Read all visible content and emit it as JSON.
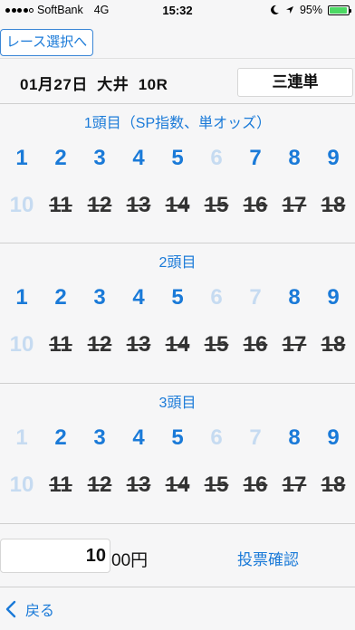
{
  "status_bar": {
    "carrier": "SoftBank",
    "network": "4G",
    "time": "15:32",
    "battery": "95%",
    "battery_level": 0.95,
    "signal_bars_filled": 4,
    "signal_bars_total": 5
  },
  "header": {
    "race_select_label": "レース選択へ",
    "race_info": "01月27日  大井  10R",
    "bet_type": "三連単"
  },
  "sections": [
    {
      "title": "1頭目（SP指数、単オッズ）",
      "rows": [
        [
          {
            "n": "1",
            "state": "active"
          },
          {
            "n": "2",
            "state": "active"
          },
          {
            "n": "3",
            "state": "active"
          },
          {
            "n": "4",
            "state": "active"
          },
          {
            "n": "5",
            "state": "active"
          },
          {
            "n": "6",
            "state": "dim"
          },
          {
            "n": "7",
            "state": "active"
          },
          {
            "n": "8",
            "state": "active"
          },
          {
            "n": "9",
            "state": "active"
          }
        ],
        [
          {
            "n": "10",
            "state": "dim"
          },
          {
            "n": "11",
            "state": "scratched"
          },
          {
            "n": "12",
            "state": "scratched"
          },
          {
            "n": "13",
            "state": "scratched"
          },
          {
            "n": "14",
            "state": "scratched"
          },
          {
            "n": "15",
            "state": "scratched"
          },
          {
            "n": "16",
            "state": "scratched"
          },
          {
            "n": "17",
            "state": "scratched"
          },
          {
            "n": "18",
            "state": "scratched"
          }
        ]
      ]
    },
    {
      "title": "2頭目",
      "rows": [
        [
          {
            "n": "1",
            "state": "active"
          },
          {
            "n": "2",
            "state": "active"
          },
          {
            "n": "3",
            "state": "active"
          },
          {
            "n": "4",
            "state": "active"
          },
          {
            "n": "5",
            "state": "active"
          },
          {
            "n": "6",
            "state": "dim"
          },
          {
            "n": "7",
            "state": "dim"
          },
          {
            "n": "8",
            "state": "active"
          },
          {
            "n": "9",
            "state": "active"
          }
        ],
        [
          {
            "n": "10",
            "state": "dim"
          },
          {
            "n": "11",
            "state": "scratched"
          },
          {
            "n": "12",
            "state": "scratched"
          },
          {
            "n": "13",
            "state": "scratched"
          },
          {
            "n": "14",
            "state": "scratched"
          },
          {
            "n": "15",
            "state": "scratched"
          },
          {
            "n": "16",
            "state": "scratched"
          },
          {
            "n": "17",
            "state": "scratched"
          },
          {
            "n": "18",
            "state": "scratched"
          }
        ]
      ]
    },
    {
      "title": "3頭目",
      "rows": [
        [
          {
            "n": "1",
            "state": "dim"
          },
          {
            "n": "2",
            "state": "active"
          },
          {
            "n": "3",
            "state": "active"
          },
          {
            "n": "4",
            "state": "active"
          },
          {
            "n": "5",
            "state": "active"
          },
          {
            "n": "6",
            "state": "dim"
          },
          {
            "n": "7",
            "state": "dim"
          },
          {
            "n": "8",
            "state": "active"
          },
          {
            "n": "9",
            "state": "active"
          }
        ],
        [
          {
            "n": "10",
            "state": "dim"
          },
          {
            "n": "11",
            "state": "scratched"
          },
          {
            "n": "12",
            "state": "scratched"
          },
          {
            "n": "13",
            "state": "scratched"
          },
          {
            "n": "14",
            "state": "scratched"
          },
          {
            "n": "15",
            "state": "scratched"
          },
          {
            "n": "16",
            "state": "scratched"
          },
          {
            "n": "17",
            "state": "scratched"
          },
          {
            "n": "18",
            "state": "scratched"
          }
        ]
      ]
    }
  ],
  "amount": {
    "value": "10",
    "suffix": "00円"
  },
  "confirm_label": "投票確認",
  "toolbar": {
    "back_label": "戻る"
  },
  "colors": {
    "accent": "#1a7ad8",
    "dim": "#c6dbf1",
    "scratched": "#333333",
    "battery": "#4cd964"
  },
  "icons": {
    "back": "chevron-left-icon",
    "moon": "moon-icon",
    "location": "location-arrow-icon"
  }
}
